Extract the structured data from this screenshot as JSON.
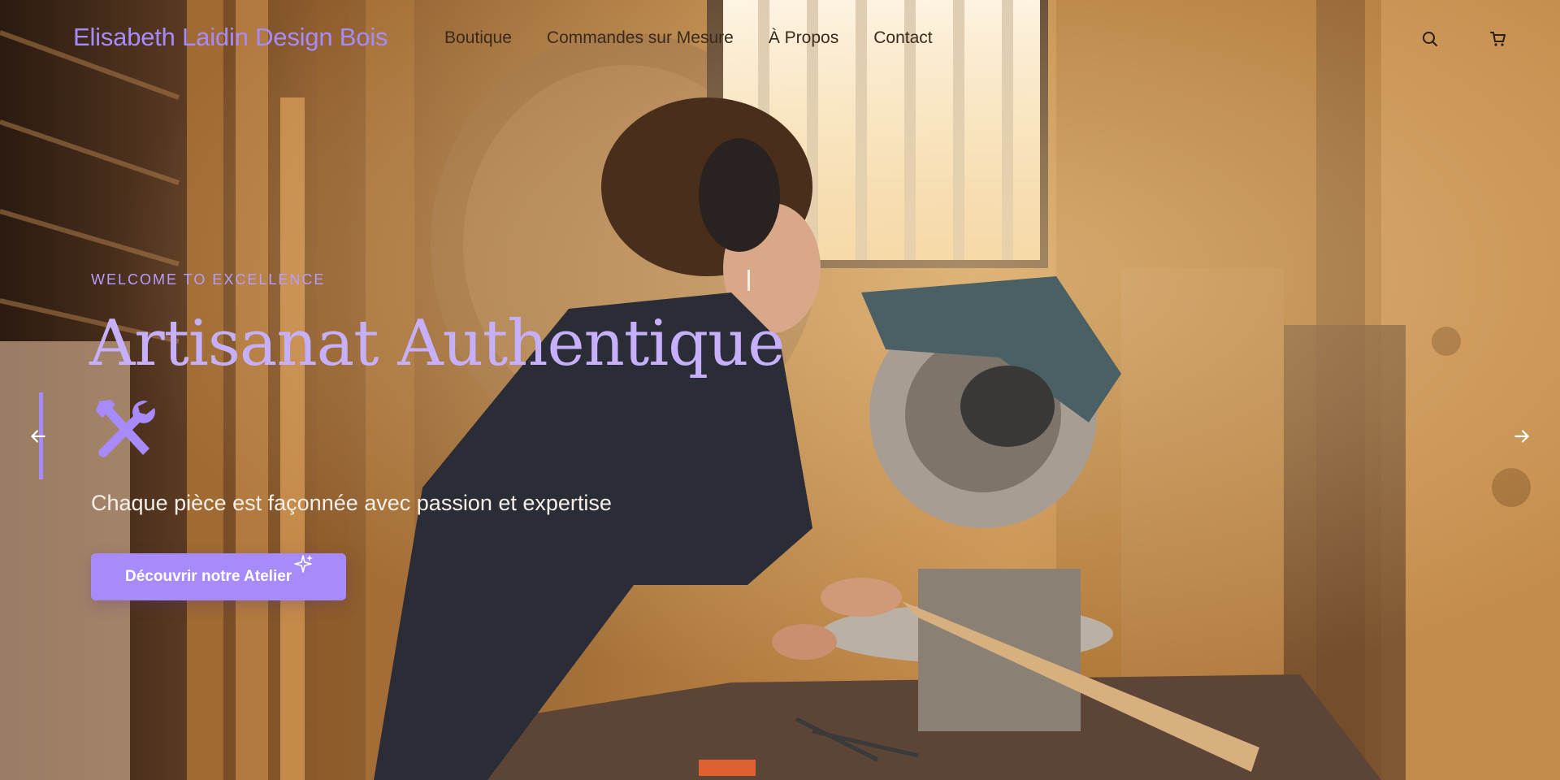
{
  "header": {
    "brand": "Elisabeth Laidin Design Bois",
    "nav": [
      {
        "label": "Boutique"
      },
      {
        "label": "Commandes sur Mesure"
      },
      {
        "label": "À Propos"
      },
      {
        "label": "Contact"
      }
    ],
    "icons": [
      "search-icon",
      "cart-icon"
    ]
  },
  "hero": {
    "eyebrow": "WELCOME TO EXCELLENCE",
    "title": "Artisanat Authentique",
    "title_icon": "hammer-wrench-icon",
    "tagline": "Chaque pièce est façonnée avec passion et expertise",
    "cta_label": "Découvrir notre Atelier",
    "cta_icon": "sparkle-icon",
    "carousel_icons": [
      "arrow-left-icon",
      "arrow-right-icon"
    ]
  },
  "colors": {
    "accent": "#a78bfa",
    "accent_light": "#c6b0fb",
    "nav_text": "#3a2a1c",
    "hero_text": "#f5efe8"
  }
}
